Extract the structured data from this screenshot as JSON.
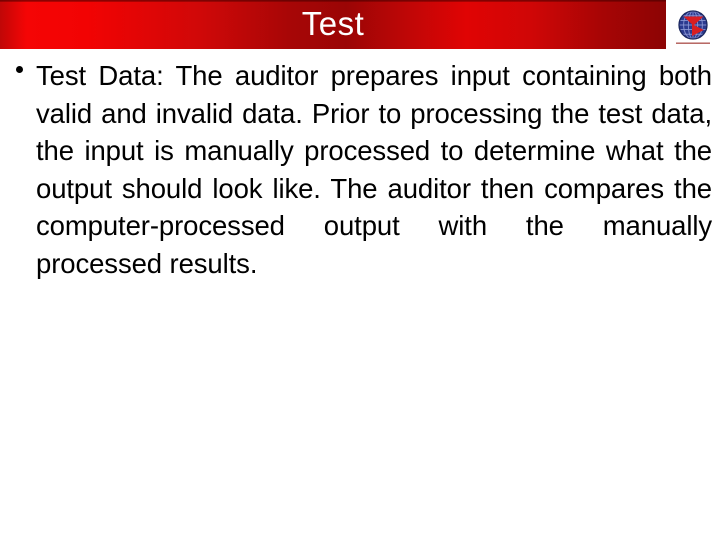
{
  "slide": {
    "title": "Test",
    "background_color": "#ffffff",
    "banner": {
      "accent_color_bright": "#f50505",
      "accent_color_dark": "#8c0404",
      "title_color": "#ffffff"
    },
    "logo": {
      "name": "globe-arrow-logo",
      "globe_color": "#2b3a8f",
      "arrow_color": "#d81e22",
      "underline_color": "#b05a55"
    },
    "body": {
      "bullets": [
        {
          "marker": "•",
          "text": "Test Data: The auditor prepares input containing both valid and invalid data.  Prior to processing the test data, the input is manually processed to determine what the output should look like.   The auditor then compares the computer-processed output with the manually processed results."
        }
      ]
    }
  }
}
